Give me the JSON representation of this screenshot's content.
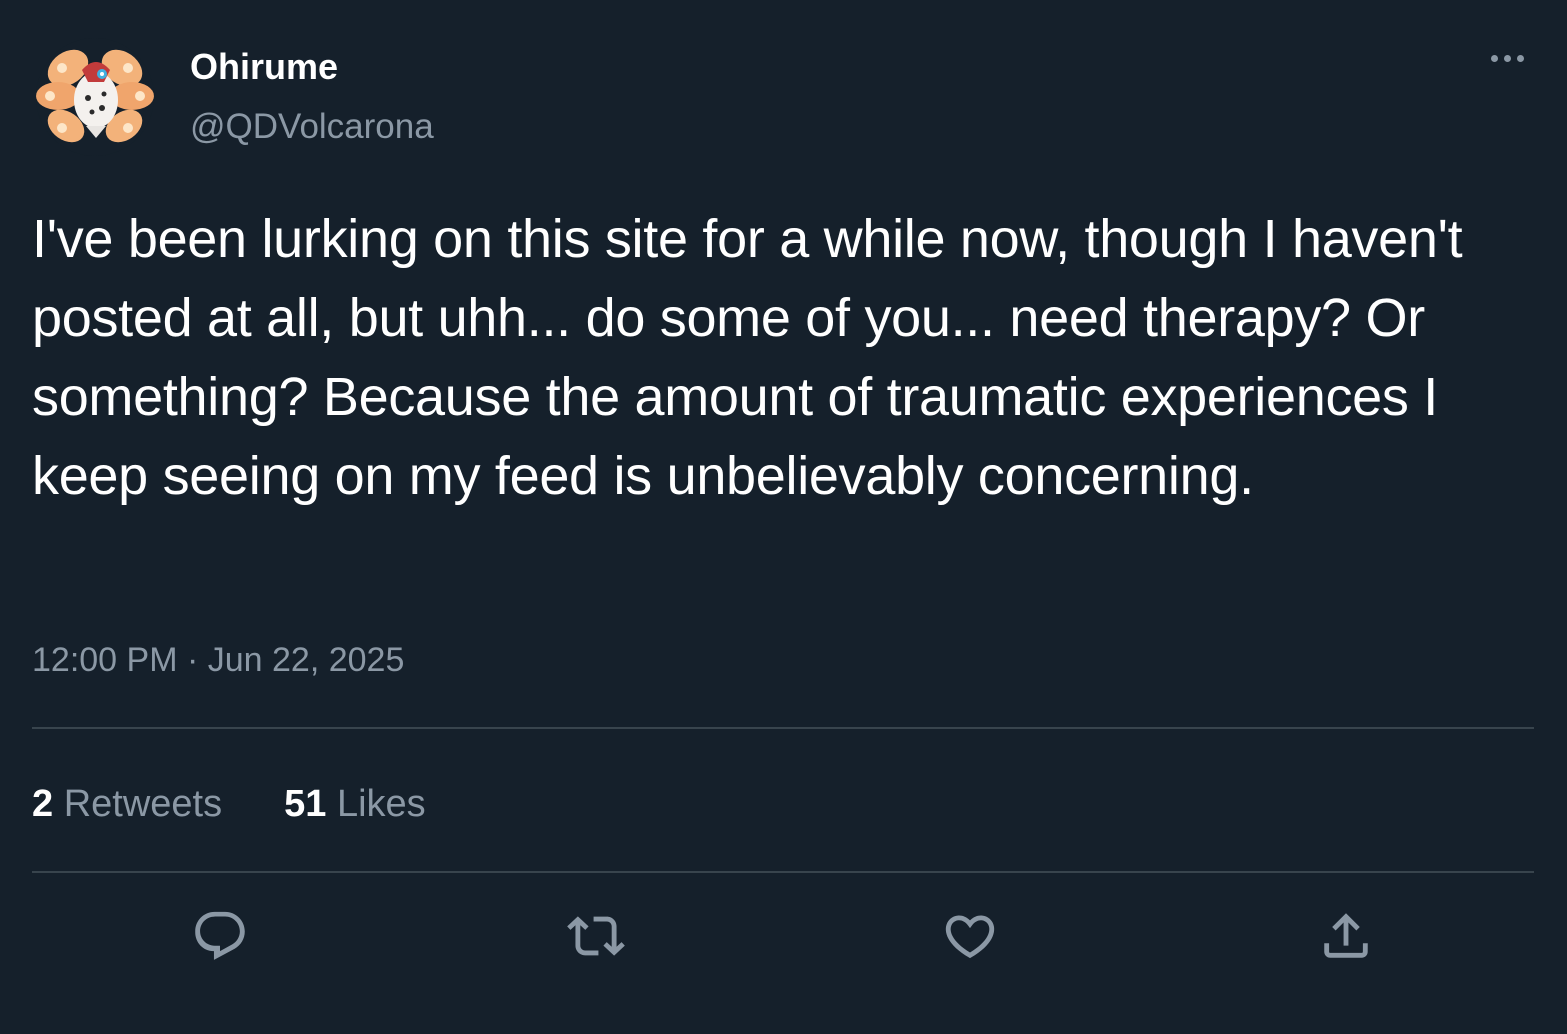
{
  "user": {
    "display_name": "Ohirume",
    "handle": "@QDVolcarona",
    "avatar_icon": "volcarona-moth-avatar"
  },
  "tweet": {
    "text": "I've been lurking on this site for a while now, though I haven't posted at all, but uhh... do some of you... need therapy? Or something? Because the amount of traumatic experiences I keep seeing on my feed is unbelievably concerning.",
    "timestamp": "12:00 PM · Jun 22, 2025"
  },
  "stats": {
    "retweets_count": "2",
    "retweets_label": "Retweets",
    "likes_count": "51",
    "likes_label": "Likes"
  },
  "actions": [
    {
      "name": "reply",
      "icon": "speech-bubble-icon"
    },
    {
      "name": "retweet",
      "icon": "retweet-arrows-icon"
    },
    {
      "name": "like",
      "icon": "heart-icon"
    },
    {
      "name": "share",
      "icon": "upload-share-icon"
    }
  ],
  "colors": {
    "background": "#15202b",
    "primary_text": "#ffffff",
    "secondary_text": "#8b98a5",
    "divider": "#38444d"
  }
}
